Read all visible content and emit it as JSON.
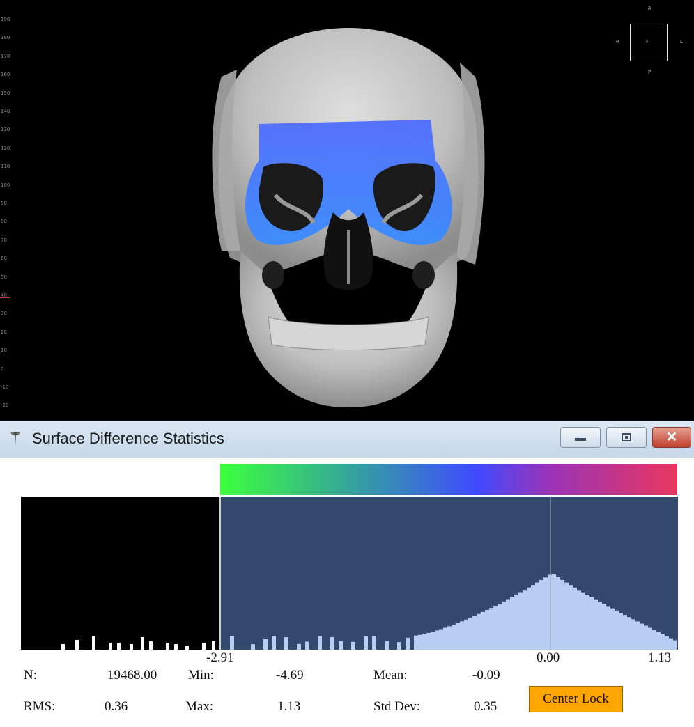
{
  "viewer": {
    "ruler_ticks": [
      "190",
      "180",
      "170",
      "160",
      "150",
      "140",
      "130",
      "120",
      "110",
      "100",
      "90",
      "80",
      "70",
      "60",
      "50",
      "40",
      "30",
      "20",
      "10",
      "0",
      "-10",
      "-20"
    ],
    "orientation": {
      "top": "A",
      "left": "R",
      "center": "F",
      "right": "L",
      "bottom": "P"
    },
    "heatmap_color": "#3f6bff",
    "bone_color": "#c8c8c8"
  },
  "dialog": {
    "title": "Surface Difference Statistics",
    "close_symbol": "✕",
    "colorbar_colors": [
      "#3dff3d",
      "#34a0a0",
      "#3f4bff",
      "#9a33b8",
      "#e8375f"
    ],
    "histogram": {
      "x_min_label": "-2.91",
      "x_zero_label": "0.00",
      "x_max_label": "1.13",
      "out_of_range_bg": "#000000",
      "in_range_bg": "#334a6e",
      "bar_color": "#b8cdf2",
      "peak_at": 0.0
    },
    "stats": {
      "n_label": "N:",
      "n_value": "19468.00",
      "min_label": "Min:",
      "min_value": "-4.69",
      "mean_label": "Mean:",
      "mean_value": "-0.09",
      "rms_label": "RMS:",
      "rms_value": "0.36",
      "max_label": "Max:",
      "max_value": "1.13",
      "std_label": "Std Dev:",
      "std_value": "0.35"
    },
    "center_lock_label": "Center Lock"
  }
}
